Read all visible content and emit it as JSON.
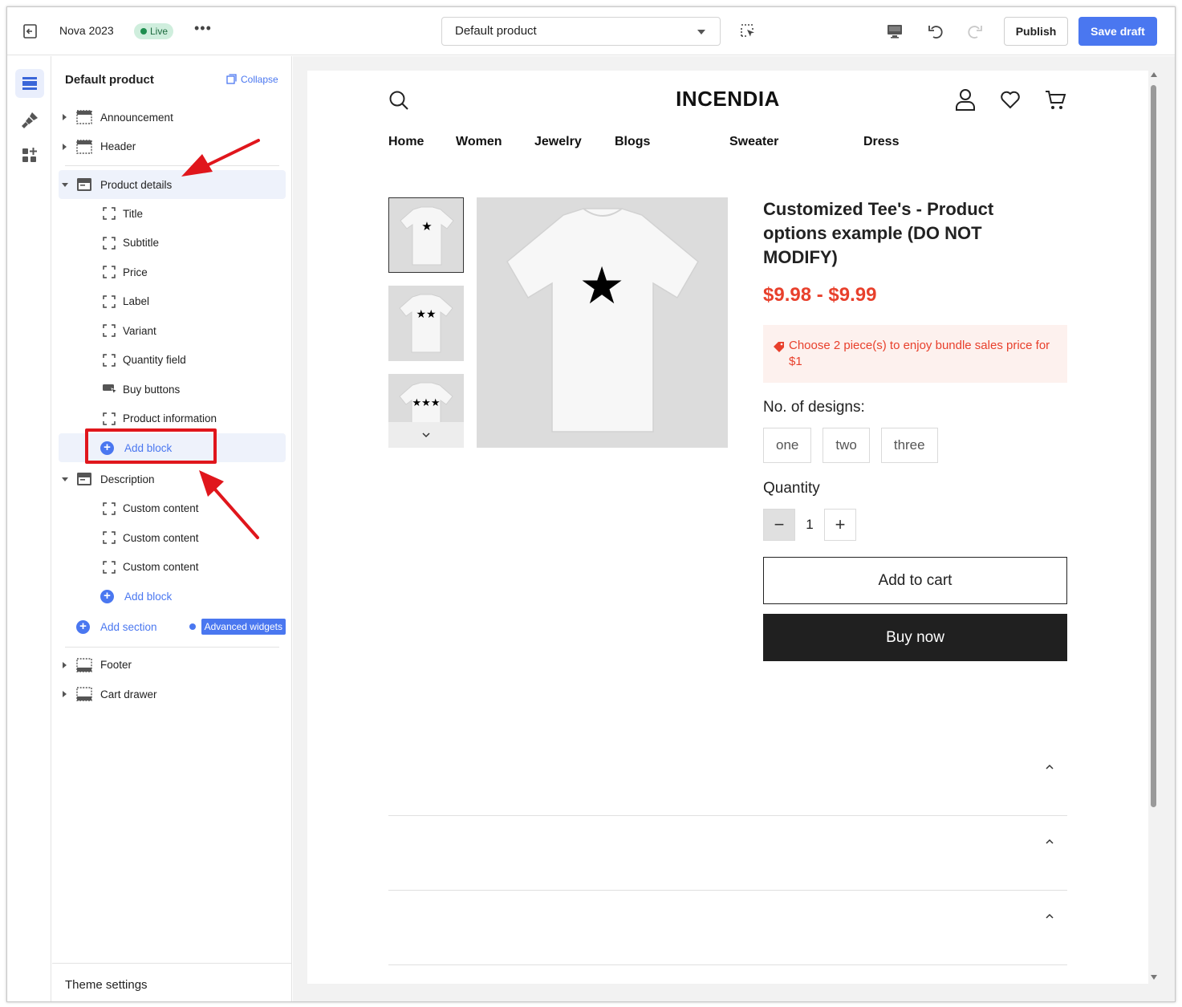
{
  "topbar": {
    "theme_name": "Nova 2023",
    "status": "Live",
    "more": "•••",
    "template_select": "Default product",
    "publish_label": "Publish",
    "save_label": "Save draft"
  },
  "sidebar": {
    "title": "Default product",
    "collapse_label": "Collapse",
    "sections_top": [
      {
        "label": "Announcement"
      },
      {
        "label": "Header"
      }
    ],
    "product_details": {
      "label": "Product details",
      "blocks": [
        "Title",
        "Subtitle",
        "Price",
        "Label",
        "Variant",
        "Quantity field",
        "Buy buttons",
        "Product information"
      ],
      "add_block": "Add block"
    },
    "description": {
      "label": "Description",
      "blocks": [
        "Custom content",
        "Custom content",
        "Custom content"
      ],
      "add_block": "Add block"
    },
    "add_section": "Add section",
    "advanced_widgets": "Advanced widgets",
    "sections_bottom": [
      {
        "label": "Footer"
      },
      {
        "label": "Cart drawer"
      }
    ],
    "theme_settings": "Theme settings"
  },
  "preview": {
    "logo": "INCENDIA",
    "nav": [
      "Home",
      "Women",
      "Jewelry",
      "Blogs",
      "Sweater",
      "Dress"
    ],
    "product": {
      "title": "Customized Tee's - Product options example (DO NOT MODIFY)",
      "price": "$9.98 - $9.99",
      "promo": "Choose 2 piece(s) to enjoy bundle sales price for $1",
      "option_label": "No. of designs:",
      "options": [
        "one",
        "two",
        "three"
      ],
      "quantity_label": "Quantity",
      "quantity_value": "1",
      "add_to_cart": "Add to cart",
      "buy_now": "Buy now"
    }
  },
  "colors": {
    "accent": "#4a77f0",
    "price": "#e8402c",
    "annotation": "#e0161c",
    "live_bg": "#cfeedd"
  }
}
